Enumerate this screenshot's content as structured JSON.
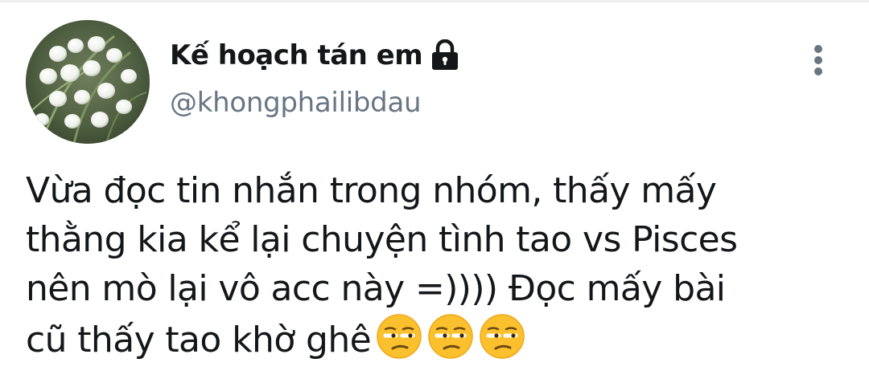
{
  "author": {
    "display_name": "Kế hoạch tán em",
    "handle": "@khongphailibdau",
    "protected_icon": "lock-icon",
    "avatar": "lily-of-the-valley-photo"
  },
  "menu": {
    "icon": "more-vertical-icon"
  },
  "tweet": {
    "lines": [
      "Vừa đọc tin nhắn trong nhóm, thấy mấy",
      "thằng kia kể lại chuyện tình tao vs Pisces",
      "nên mò lại vô acc này =)))) Đọc mấy bài",
      "cũ thấy tao khờ ghê"
    ],
    "emojis": [
      "unamused-face-emoji",
      "unamused-face-emoji",
      "unamused-face-emoji"
    ]
  },
  "colors": {
    "text": "#14171a",
    "secondary": "#687684",
    "emoji": "#fbc02d"
  }
}
